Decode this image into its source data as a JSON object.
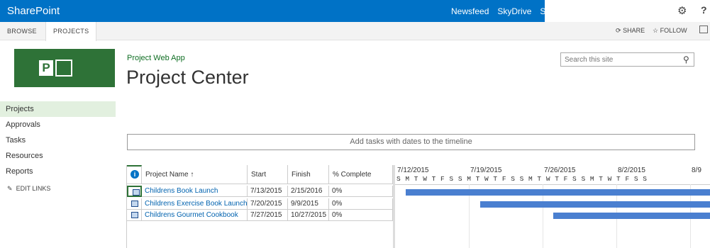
{
  "suite": {
    "brand": "SharePoint",
    "links": [
      "Newsfeed",
      "SkyDrive",
      "Sites"
    ],
    "settings_icon": "gear-icon",
    "help_label": "?"
  },
  "ribbon": {
    "tabs": [
      "BROWSE",
      "PROJECTS"
    ],
    "share": "SHARE",
    "follow": "FOLLOW"
  },
  "site": {
    "title": "Project Web App",
    "page_title": "Project Center",
    "logo_letter": "P"
  },
  "search": {
    "placeholder": "Search this site"
  },
  "nav": {
    "items": [
      "Projects",
      "Approvals",
      "Tasks",
      "Resources",
      "Reports"
    ],
    "edit_links": "EDIT LINKS"
  },
  "timeline": {
    "prompt": "Add tasks with dates to the timeline"
  },
  "grid": {
    "columns": [
      "Project Name ↑",
      "Start",
      "Finish",
      "% Complete"
    ],
    "rows": [
      {
        "name": "Childrens Book Launch",
        "start": "7/13/2015",
        "finish": "2/15/2016",
        "complete": "0%"
      },
      {
        "name": "Childrens Exercise Book Launch",
        "start": "7/20/2015",
        "finish": "9/9/2015",
        "complete": "0%"
      },
      {
        "name": "Childrens Gourmet Cookbook",
        "start": "7/27/2015",
        "finish": "10/27/2015",
        "complete": "0%"
      }
    ]
  },
  "gantt": {
    "weeks": [
      "7/12/2015",
      "7/19/2015",
      "7/26/2015",
      "8/2/2015",
      "8/9"
    ],
    "days": "S M T W T F S S M T W T F S S M T W T F S S M T W T F S S"
  },
  "colors": {
    "suite_bar": "#0072c6",
    "accent_green": "#2e7237",
    "gantt_bar": "#4a7fd0",
    "link": "#0062af"
  }
}
